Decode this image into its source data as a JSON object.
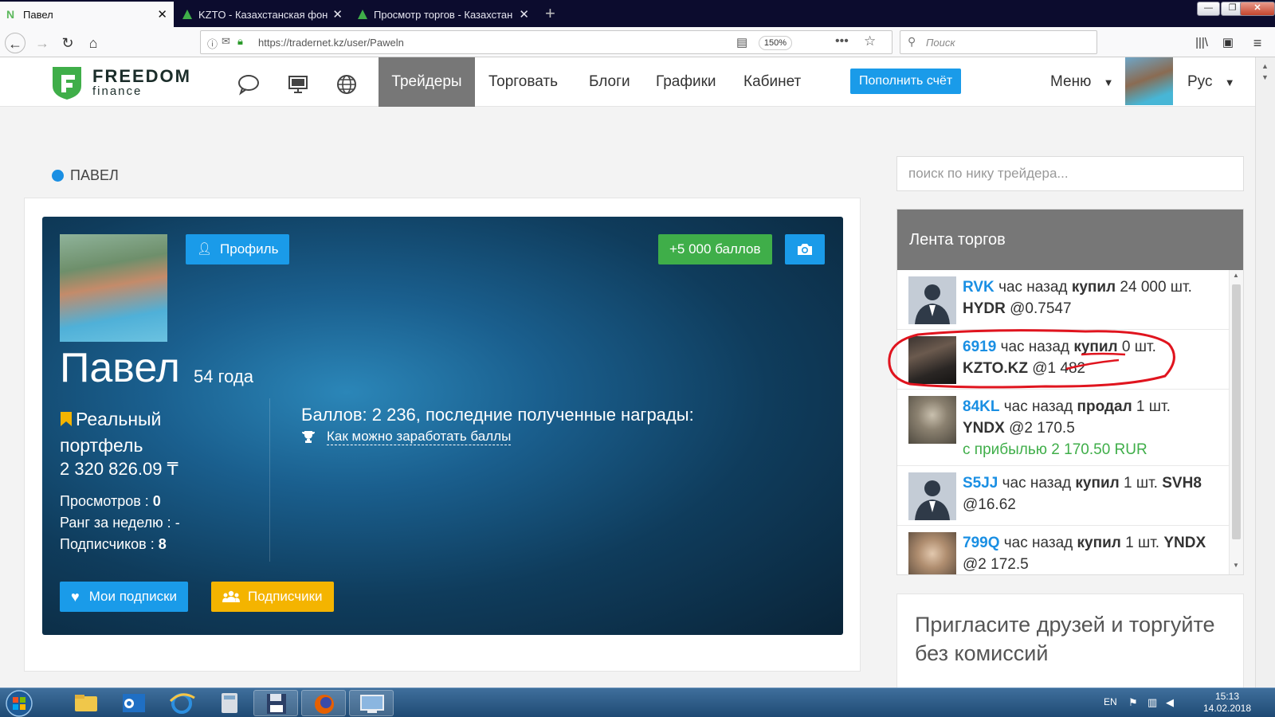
{
  "browser": {
    "tabs": [
      {
        "title": "Павел",
        "active": true
      },
      {
        "title": "KZTO - Казахстанская фондов",
        "active": false
      },
      {
        "title": "Просмотр торгов - Казахстан",
        "active": false
      }
    ],
    "url": "https://tradernet.kz/user/Paweln",
    "zoom": "150%",
    "search_placeholder": "Поиск"
  },
  "header": {
    "logo_title": "FREEDOM",
    "logo_subtitle": "finance",
    "nav": [
      "Трейдеры",
      "Торговать",
      "Блоги",
      "Графики",
      "Кабинет"
    ],
    "topup_label": "Пополнить счёт",
    "menu_label": "Меню",
    "lang_label": "Рус"
  },
  "page": {
    "title": "ПАВЕЛ",
    "profile_button": "Профиль",
    "points_button": "+5 000 баллов",
    "name": "Павел",
    "age": "54 года",
    "portfolio_label": "Реальный портфель",
    "portfolio_value": "2 320 826.09 ₸",
    "views_label": "Просмотров :",
    "views_value": "0",
    "rank_label": "Ранг за неделю :",
    "rank_value": "-",
    "followers_label": "Подписчиков :",
    "followers_value": "8",
    "points_text": "Баллов: 2 236, последние полученные награды:",
    "earn_link": "Как можно заработать баллы",
    "my_subscriptions_button": "Мои подписки",
    "followers_button": "Подписчики"
  },
  "sidebar": {
    "trader_search_placeholder": "поиск по нику трейдера...",
    "feed_title": "Лента торгов",
    "feed": [
      {
        "nick": "RVK",
        "time": "час назад",
        "action": "купил",
        "qty": "24 000 шт.",
        "ticker": "HYDR",
        "price": "@0.7547",
        "profit": ""
      },
      {
        "nick": "6919",
        "time": "час назад",
        "action": "купил",
        "qty": "0 шт.",
        "ticker": "KZTO.KZ",
        "price": "@1 482",
        "profit": ""
      },
      {
        "nick": "84KL",
        "time": "час назад",
        "action": "продал",
        "qty": "1 шт.",
        "ticker": "YNDX",
        "price": "@2 170.5",
        "profit": "с прибылью 2 170.50 RUR"
      },
      {
        "nick": "S5JJ",
        "time": "час назад",
        "action": "купил",
        "qty": "1 шт.",
        "ticker": "SVH8",
        "price": "@16.62",
        "profit": ""
      },
      {
        "nick": "799Q",
        "time": "час назад",
        "action": "купил",
        "qty": "1 шт.",
        "ticker": "YNDX",
        "price": "@2 172.5",
        "profit": ""
      }
    ],
    "invite_text": "Пригласите друзей и торгуйте без комиссий"
  },
  "taskbar": {
    "lang": "EN",
    "time": "15:13",
    "date": "14.02.2018"
  },
  "colors": {
    "accent_blue": "#1a9be9",
    "green": "#3fae49",
    "yellow": "#f4b400",
    "annotation_red": "#e0141e"
  }
}
